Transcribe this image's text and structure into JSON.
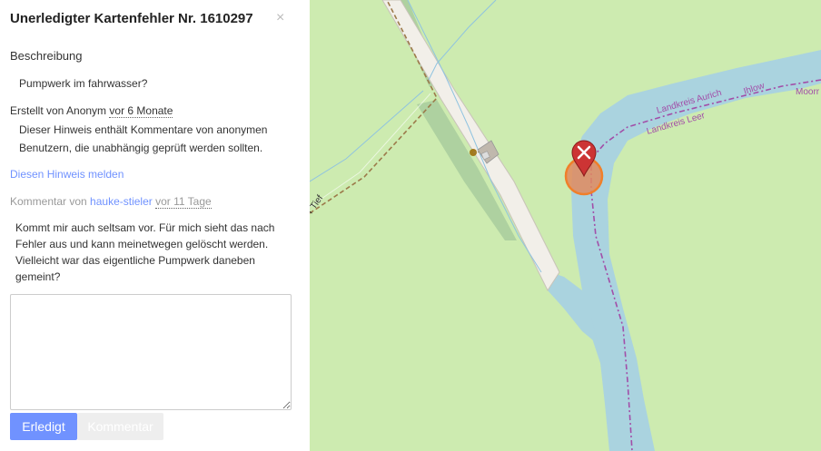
{
  "sidebar": {
    "title": "Unerledigter Kartenfehler Nr. 1610297",
    "close_glyph": "×",
    "description_heading": "Beschreibung",
    "description_text": "Pumpwerk im fahrwasser?",
    "created_prefix": "Erstellt von Anonym ",
    "created_time": "vor 6 Monate",
    "anonymous_note": "Dieser Hinweis enthält Kommentare von anonymen Benutzern, die unabhängig geprüft werden sollten.",
    "report_link": "Diesen Hinweis melden",
    "comment_prefix": "Kommentar von ",
    "comment_author": "hauke-stieler",
    "comment_time": "vor 11 Tage",
    "comment_text": "Kommt mir auch seltsam vor. Für mich sieht das nach Fehler aus und kann meinetwegen gelöscht werden. Vielleicht war das eigentliche Pumpwerk daneben gemeint?",
    "textarea_value": "",
    "resolve_button": "Erledigt",
    "comment_button": "Kommentar"
  },
  "map": {
    "labels": {
      "district_aurich": "Landkreis Aurich",
      "district_leer": "Landkreis Leer",
      "place_ihlow": "Ihlow",
      "place_moorr": "Moorr",
      "road_tief": "r Tief"
    },
    "colors": {
      "land": "#cdebb0",
      "water": "#aad3df",
      "boundary": "#a24ea8",
      "marker": "#cc3434",
      "highlight": "#f07f2a"
    },
    "icons": [
      "note-closed-marker-icon",
      "building-icon",
      "pump-node-icon"
    ]
  }
}
